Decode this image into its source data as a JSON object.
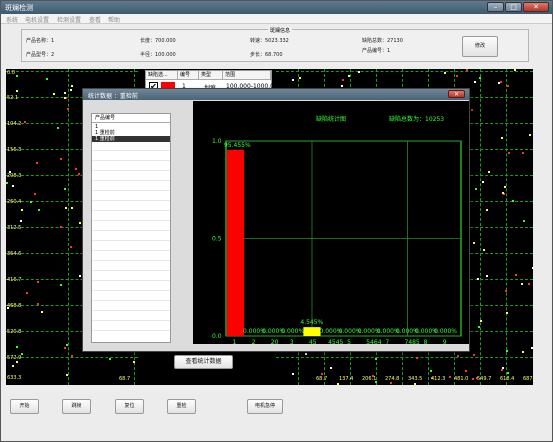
{
  "window": {
    "title": "斑斓检测"
  },
  "menu": {
    "items": [
      "系统",
      "电机设置",
      "检测设置",
      "查看",
      "帮助"
    ]
  },
  "info": {
    "section_title": "斑斓信息",
    "product_name": "产品名称：1",
    "length": "长度：700.000",
    "speed": "转速：5023.332",
    "defect_total": "缺陷总数：27130",
    "product_model": "产品型号：2",
    "radius": "半径：100.000",
    "step": "步长：68.700",
    "product_number": "产品编号：1",
    "modify_button": "修改"
  },
  "left_map": {
    "y_labels": [
      "0.0",
      "52.1",
      "104.2",
      "156.3",
      "208.3",
      "260.4",
      "312.5",
      "364.6",
      "416.7",
      "468.8",
      "520.8",
      "572.9",
      "633.3"
    ],
    "x_end_label": "68.7"
  },
  "right_map": {
    "x_labels": [
      "68.7",
      "137.4",
      "206.1",
      "274.8",
      "343.5",
      "412.3",
      "481.0",
      "549.7",
      "618.4",
      "687.1"
    ]
  },
  "defect_table": {
    "headers": [
      "缺陷选...",
      "编号",
      "类型",
      "范围"
    ],
    "row": {
      "number": "1",
      "type": "划痕",
      "range": "100.000-1000.0"
    }
  },
  "stats_dialog": {
    "title": "统计数据 ：重检前",
    "list_header": "产品编号",
    "list_items": [
      "1",
      "1 重检前",
      "1 重检前"
    ],
    "chart_title": "缺陷统计图",
    "defect_count_label": "缺陷总数为：10253"
  },
  "chart_data": {
    "type": "bar",
    "categories": [
      "1",
      "2",
      "20",
      "3",
      "45",
      "4545",
      "5",
      "5464",
      "7",
      "7485",
      "8",
      "9"
    ],
    "values": [
      95.455,
      0.0,
      0.0,
      0.0,
      4.545,
      0.0,
      0.0,
      0.0,
      0.0,
      0.0,
      0.0,
      0.0
    ],
    "data_labels": [
      "95.455%",
      "0.000%",
      "0.000%",
      "0.000%",
      "4.545%",
      "0.000%",
      "0.000%",
      "0.000%",
      "0.000%",
      "0.000%",
      "0.000%",
      "0.000%"
    ],
    "bar_colors": [
      "#ff0000",
      "#ffffff",
      "#ffffff",
      "#ffffff",
      "#ffff00",
      "#ffffff",
      "#ffffff",
      "#ffffff",
      "#ffffff",
      "#ffffff",
      "#ffffff",
      "#ffffff"
    ],
    "y_ticks": [
      "0.0",
      "0.5",
      "1.0"
    ],
    "ylim": [
      0,
      1
    ],
    "title": "缺陷统计图",
    "grid": true,
    "colors": {
      "axis": "#33ff33",
      "grid": "#2a8a2a",
      "label": "#33ff33"
    }
  },
  "buttons": {
    "view_stats": "查看统计数据",
    "start": "开始",
    "jump": "跳帧",
    "reset": "复位",
    "recheck": "重检",
    "motor_stop": "电机急停"
  }
}
